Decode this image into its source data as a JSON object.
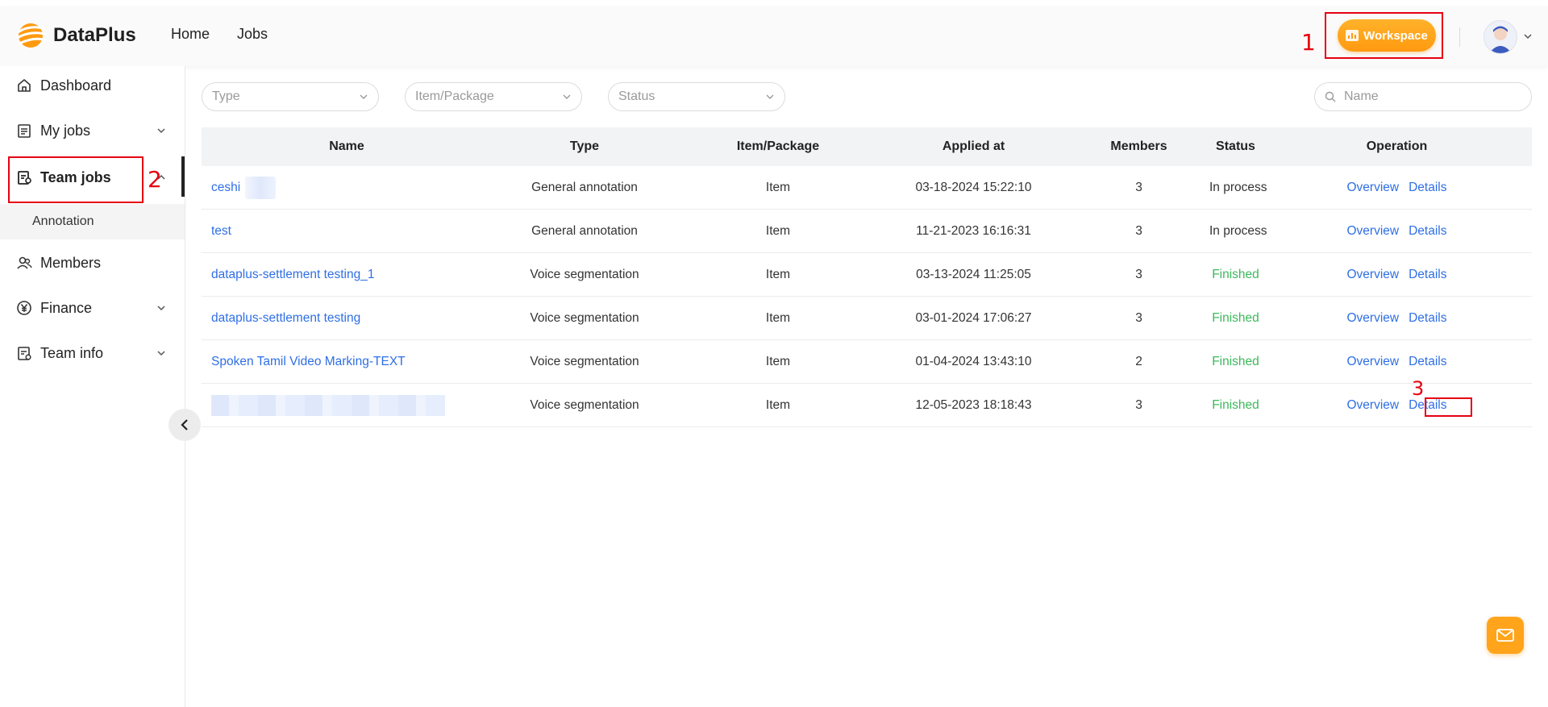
{
  "brand": {
    "name": "DataPlus",
    "color": "#ff9a10"
  },
  "topnav": {
    "home": "Home",
    "jobs": "Jobs"
  },
  "header": {
    "workspace_label": "Workspace"
  },
  "annotations": {
    "one": "1",
    "two": "2",
    "three": "3"
  },
  "sidebar": {
    "items": [
      {
        "label": "Dashboard",
        "icon": "home-icon"
      },
      {
        "label": "My jobs",
        "icon": "clipboard-icon"
      },
      {
        "label": "Team jobs",
        "icon": "team-jobs-icon"
      },
      {
        "label": "Members",
        "icon": "members-icon"
      },
      {
        "label": "Finance",
        "icon": "yen-icon"
      },
      {
        "label": "Team info",
        "icon": "team-info-icon"
      }
    ],
    "sub_item": "Annotation"
  },
  "filters": {
    "type_placeholder": "Type",
    "item_placeholder": "Item/Package",
    "status_placeholder": "Status",
    "search_placeholder": "Name"
  },
  "table": {
    "columns": [
      "Name",
      "Type",
      "Item/Package",
      "Applied at",
      "Members",
      "Status",
      "Operation"
    ],
    "rows": [
      {
        "name": "ceshi",
        "type": "General annotation",
        "item": "Item",
        "applied": "03-18-2024 15:22:10",
        "members": "3",
        "status": "In process"
      },
      {
        "name": "test",
        "type": "General annotation",
        "item": "Item",
        "applied": "11-21-2023 16:16:31",
        "members": "3",
        "status": "In process"
      },
      {
        "name": "dataplus-settlement testing_1",
        "type": "Voice segmentation",
        "item": "Item",
        "applied": "03-13-2024 11:25:05",
        "members": "3",
        "status": "Finished"
      },
      {
        "name": "dataplus-settlement testing",
        "type": "Voice segmentation",
        "item": "Item",
        "applied": "03-01-2024 17:06:27",
        "members": "3",
        "status": "Finished"
      },
      {
        "name": "Spoken Tamil Video Marking-TEXT",
        "type": "Voice segmentation",
        "item": "Item",
        "applied": "01-04-2024 13:43:10",
        "members": "2",
        "status": "Finished"
      },
      {
        "name": "",
        "type": "Voice segmentation",
        "item": "Item",
        "applied": "12-05-2023 18:18:43",
        "members": "3",
        "status": "Finished"
      }
    ],
    "op_overview": "Overview",
    "op_details": "Details"
  },
  "colors": {
    "link": "#2f6fe4",
    "finished": "#3cb95b",
    "annotation_red": "#e60012"
  }
}
